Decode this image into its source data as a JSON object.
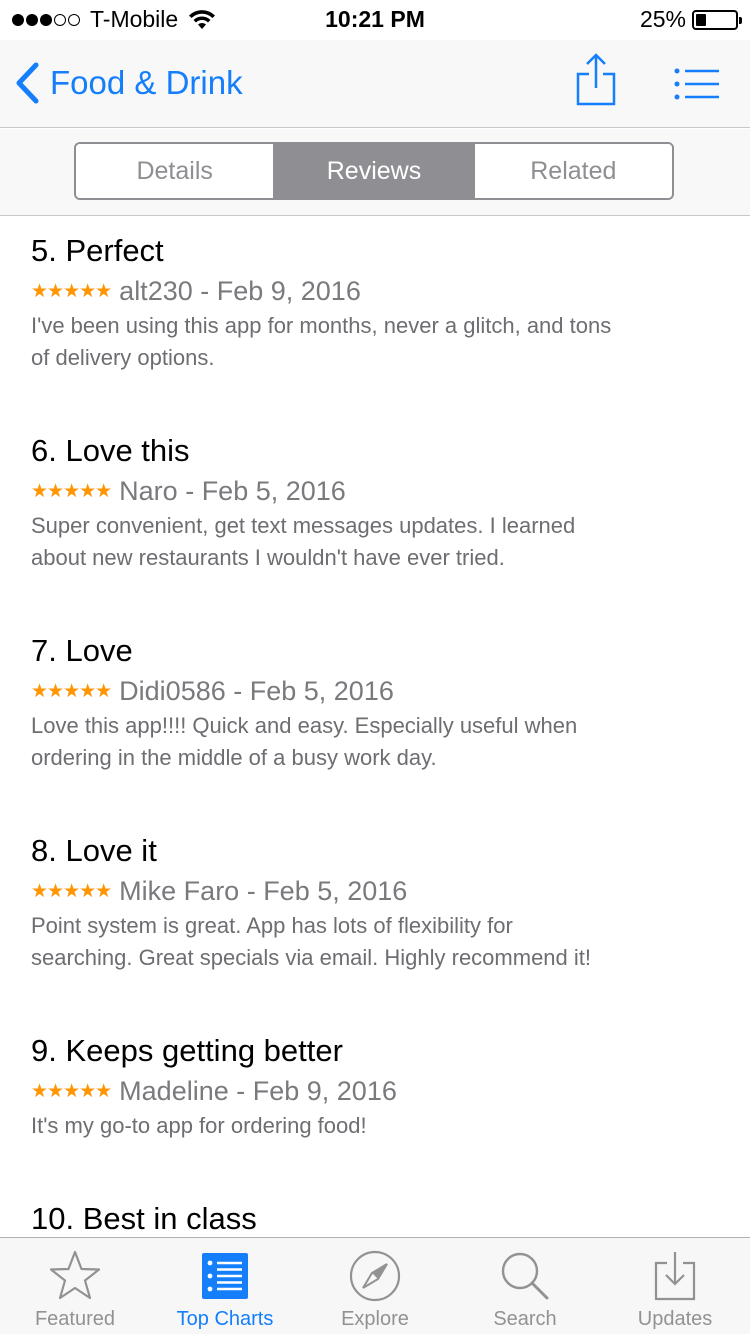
{
  "status_bar": {
    "carrier": "T-Mobile",
    "signal_bars_filled": 3,
    "signal_bars_total": 5,
    "time": "10:21 PM",
    "battery": "25%",
    "battery_level": 0.25
  },
  "nav": {
    "back_label": "Food & Drink",
    "share_icon": "share-icon",
    "list_icon": "list-icon",
    "accent": "#147efb"
  },
  "segments": [
    {
      "label": "Details",
      "active": false
    },
    {
      "label": "Reviews",
      "active": true
    },
    {
      "label": "Related",
      "active": false
    }
  ],
  "reviews": [
    {
      "title": "5. Perfect",
      "stars": "★★★★★",
      "rating": 5,
      "meta": "alt230 - Feb 9, 2016",
      "body_lines": [
        "I've been using this app for months, never a glitch, and tons",
        "of delivery options."
      ]
    },
    {
      "title": "6. Love this",
      "stars": "★★★★★",
      "rating": 5,
      "meta": "Naro - Feb 5, 2016",
      "body_lines": [
        "Super convenient, get text messages updates.  I learned",
        "about new restaurants I wouldn't have ever tried."
      ]
    },
    {
      "title": "7. Love",
      "stars": "★★★★★",
      "rating": 5,
      "meta": "Didi0586 - Feb 5, 2016",
      "body_lines": [
        "Love this app!!!! Quick and easy. Especially useful when",
        "ordering in the middle of a busy work day."
      ]
    },
    {
      "title": "8. Love it",
      "stars": "★★★★★",
      "rating": 5,
      "meta": "Mike Faro - Feb 5, 2016",
      "body_lines": [
        "Point system is great. App has lots of flexibility for",
        "searching. Great specials via email. Highly recommend it!"
      ]
    },
    {
      "title": "9. Keeps getting better",
      "stars": "★★★★★",
      "rating": 5,
      "meta": "Madeline - Feb 9, 2016",
      "body_lines": [
        "It's my go-to app for ordering food!"
      ]
    },
    {
      "title": "10. Best in class",
      "stars": "",
      "meta": "",
      "body_lines": []
    }
  ],
  "tabbar": [
    {
      "label": "Featured",
      "icon": "star-icon",
      "active": false
    },
    {
      "label": "Top Charts",
      "icon": "top-charts-icon",
      "active": true
    },
    {
      "label": "Explore",
      "icon": "compass-icon",
      "active": false
    },
    {
      "label": "Search",
      "icon": "search-icon",
      "active": false
    },
    {
      "label": "Updates",
      "icon": "updates-icon",
      "active": false
    }
  ]
}
